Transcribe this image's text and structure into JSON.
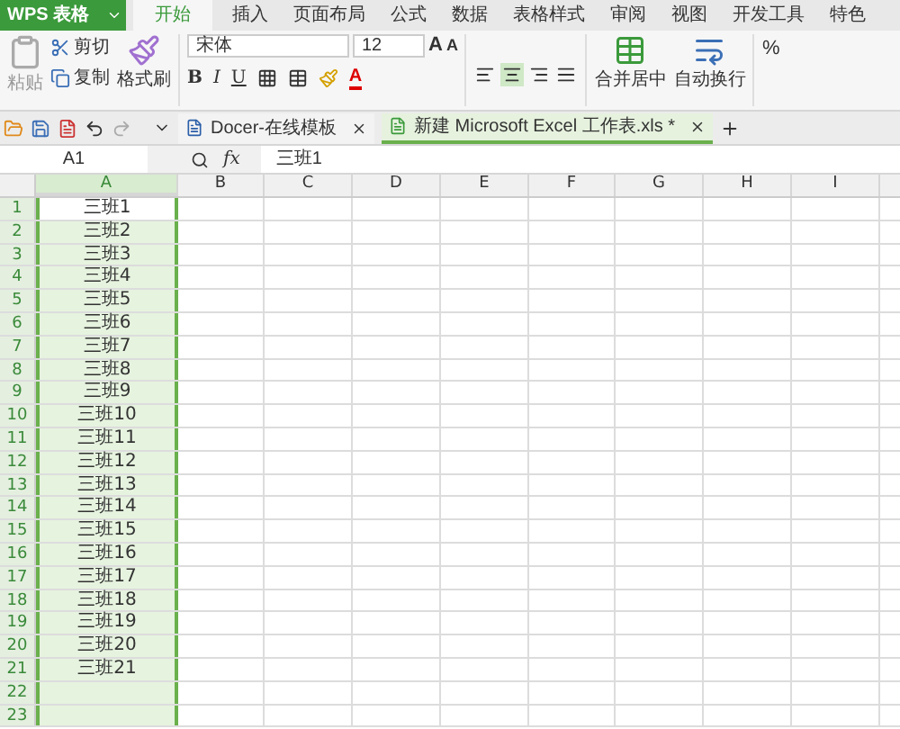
{
  "app_button": "WPS 表格",
  "ribbon_tabs": [
    {
      "label": "开始",
      "selected": true
    },
    {
      "label": "插入",
      "selected": false
    },
    {
      "label": "页面布局",
      "selected": false
    },
    {
      "label": "公式",
      "selected": false
    },
    {
      "label": "数据",
      "selected": false
    },
    {
      "label": "表格样式",
      "selected": false
    },
    {
      "label": "审阅",
      "selected": false
    },
    {
      "label": "视图",
      "selected": false
    },
    {
      "label": "开发工具",
      "selected": false
    },
    {
      "label": "特色",
      "selected": false
    }
  ],
  "clipboard": {
    "paste": "粘贴",
    "cut": "剪切",
    "copy": "复制",
    "format_painter": "格式刷"
  },
  "font": {
    "name": "宋体",
    "size": "12",
    "grow": "A",
    "shrink": "A",
    "styles": [
      "B",
      "I",
      "U"
    ],
    "color_button": "A"
  },
  "alignments": [
    {
      "kind": "left",
      "selected": false
    },
    {
      "kind": "center",
      "selected": true
    },
    {
      "kind": "right",
      "selected": false
    },
    {
      "kind": "justify",
      "selected": false
    }
  ],
  "merge_button": "合并居中",
  "wrap_button": "自动换行",
  "percent": "%",
  "doc_tabs": [
    {
      "label": "Docer-在线模板",
      "selected": false
    },
    {
      "label": "新建 Microsoft Excel 工作表.xls *",
      "selected": true
    }
  ],
  "name_box": "A1",
  "fx": "fx",
  "formula": "三班1",
  "columns": [
    {
      "label": "A",
      "selected": true
    },
    {
      "label": "B",
      "selected": false
    },
    {
      "label": "C",
      "selected": false
    },
    {
      "label": "D",
      "selected": false
    },
    {
      "label": "E",
      "selected": false
    },
    {
      "label": "F",
      "selected": false
    },
    {
      "label": "G",
      "selected": false
    },
    {
      "label": "H",
      "selected": false
    },
    {
      "label": "I",
      "selected": false
    }
  ],
  "rows": [
    {
      "label": "1",
      "cell": "三班1",
      "selected": true,
      "active": true
    },
    {
      "label": "2",
      "cell": "三班2",
      "selected": true,
      "active": false
    },
    {
      "label": "3",
      "cell": "三班3",
      "selected": true,
      "active": false
    },
    {
      "label": "4",
      "cell": "三班4",
      "selected": true,
      "active": false
    },
    {
      "label": "5",
      "cell": "三班5",
      "selected": true,
      "active": false
    },
    {
      "label": "6",
      "cell": "三班6",
      "selected": true,
      "active": false
    },
    {
      "label": "7",
      "cell": "三班7",
      "selected": true,
      "active": false
    },
    {
      "label": "8",
      "cell": "三班8",
      "selected": true,
      "active": false
    },
    {
      "label": "9",
      "cell": "三班9",
      "selected": true,
      "active": false
    },
    {
      "label": "10",
      "cell": "三班10",
      "selected": true,
      "active": false
    },
    {
      "label": "11",
      "cell": "三班11",
      "selected": true,
      "active": false
    },
    {
      "label": "12",
      "cell": "三班12",
      "selected": true,
      "active": false
    },
    {
      "label": "13",
      "cell": "三班13",
      "selected": true,
      "active": false
    },
    {
      "label": "14",
      "cell": "三班14",
      "selected": true,
      "active": false
    },
    {
      "label": "15",
      "cell": "三班15",
      "selected": true,
      "active": false
    },
    {
      "label": "16",
      "cell": "三班16",
      "selected": true,
      "active": false
    },
    {
      "label": "17",
      "cell": "三班17",
      "selected": true,
      "active": false
    },
    {
      "label": "18",
      "cell": "三班18",
      "selected": true,
      "active": false
    },
    {
      "label": "19",
      "cell": "三班19",
      "selected": true,
      "active": false
    },
    {
      "label": "20",
      "cell": "三班20",
      "selected": true,
      "active": false
    },
    {
      "label": "21",
      "cell": "三班21",
      "selected": true,
      "active": false
    },
    {
      "label": "22",
      "selected": true,
      "active": false
    },
    {
      "label": "23",
      "selected": true,
      "active": false
    }
  ]
}
